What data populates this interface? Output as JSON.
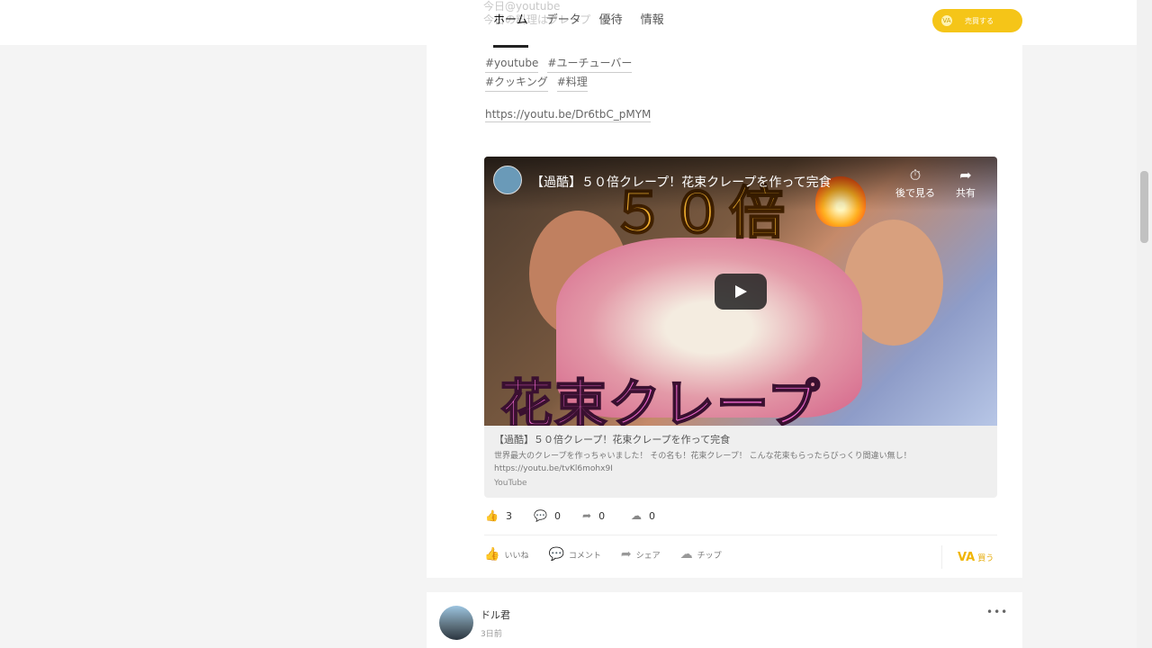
{
  "header": {
    "ghost_line1": "今日@youtube",
    "ghost_line2": "今日の料理はクレープ",
    "tabs": [
      {
        "label": "ホーム",
        "active": true
      },
      {
        "label": "データ",
        "active": false
      },
      {
        "label": "優待",
        "active": false
      },
      {
        "label": "情報",
        "active": false
      }
    ],
    "buy_button": "売買する",
    "buy_icon": "VA"
  },
  "post": {
    "tags_row1": [
      "#youtube",
      "#ユーチューバー"
    ],
    "tags_row2": [
      "#クッキング",
      "#料理"
    ],
    "link": "https://youtu.be/Dr6tbC_pMYM",
    "embed": {
      "video_title": "【過酷】５０倍クレープ！花束クレープを作って完食",
      "thumb_text": "５０倍",
      "thumb_caption": "花束クレープ",
      "watch_later": "後で見る",
      "share": "共有",
      "card_title": "【過酷】５０倍クレープ！花束クレープを作って完食",
      "card_desc_line1": "世界最大のクレープを作っちゃいました！ その名も！花束クレープ！ こんな花束もらったらびっくり間違い無し！",
      "card_desc_line2": "https://youtu.be/tvKl6mohx9I",
      "card_source": "YouTube"
    },
    "stats": {
      "likes": "3",
      "comments": "0",
      "shares": "0",
      "tips": "0"
    },
    "actions": {
      "like": "いいね",
      "comment": "コメント",
      "share": "シェア",
      "tip": "チップ",
      "buy": "買う",
      "buy_icon": "VA"
    }
  },
  "next_post": {
    "user": "ドル君",
    "time": "3日前",
    "more": "•••"
  },
  "colors": {
    "accent": "#f5c518",
    "page_bg": "#f4f4f4"
  }
}
